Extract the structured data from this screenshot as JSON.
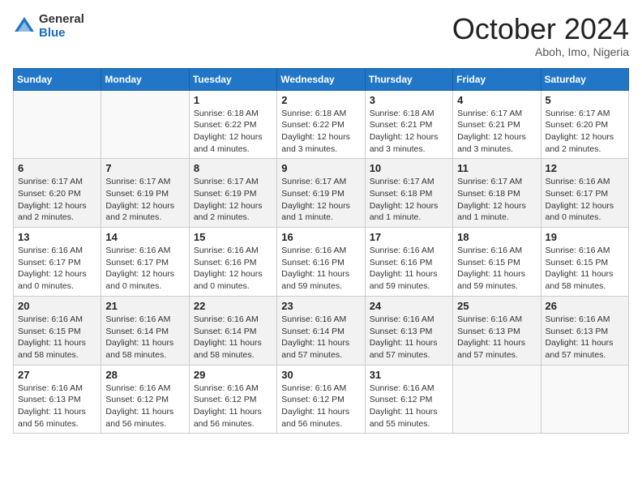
{
  "logo": {
    "general": "General",
    "blue": "Blue"
  },
  "title": "October 2024",
  "subtitle": "Aboh, Imo, Nigeria",
  "days_of_week": [
    "Sunday",
    "Monday",
    "Tuesday",
    "Wednesday",
    "Thursday",
    "Friday",
    "Saturday"
  ],
  "weeks": [
    [
      {
        "day": "",
        "info": ""
      },
      {
        "day": "",
        "info": ""
      },
      {
        "day": "1",
        "info": "Sunrise: 6:18 AM\nSunset: 6:22 PM\nDaylight: 12 hours and 4 minutes."
      },
      {
        "day": "2",
        "info": "Sunrise: 6:18 AM\nSunset: 6:22 PM\nDaylight: 12 hours and 3 minutes."
      },
      {
        "day": "3",
        "info": "Sunrise: 6:18 AM\nSunset: 6:21 PM\nDaylight: 12 hours and 3 minutes."
      },
      {
        "day": "4",
        "info": "Sunrise: 6:17 AM\nSunset: 6:21 PM\nDaylight: 12 hours and 3 minutes."
      },
      {
        "day": "5",
        "info": "Sunrise: 6:17 AM\nSunset: 6:20 PM\nDaylight: 12 hours and 2 minutes."
      }
    ],
    [
      {
        "day": "6",
        "info": "Sunrise: 6:17 AM\nSunset: 6:20 PM\nDaylight: 12 hours and 2 minutes."
      },
      {
        "day": "7",
        "info": "Sunrise: 6:17 AM\nSunset: 6:19 PM\nDaylight: 12 hours and 2 minutes."
      },
      {
        "day": "8",
        "info": "Sunrise: 6:17 AM\nSunset: 6:19 PM\nDaylight: 12 hours and 2 minutes."
      },
      {
        "day": "9",
        "info": "Sunrise: 6:17 AM\nSunset: 6:19 PM\nDaylight: 12 hours and 1 minute."
      },
      {
        "day": "10",
        "info": "Sunrise: 6:17 AM\nSunset: 6:18 PM\nDaylight: 12 hours and 1 minute."
      },
      {
        "day": "11",
        "info": "Sunrise: 6:17 AM\nSunset: 6:18 PM\nDaylight: 12 hours and 1 minute."
      },
      {
        "day": "12",
        "info": "Sunrise: 6:16 AM\nSunset: 6:17 PM\nDaylight: 12 hours and 0 minutes."
      }
    ],
    [
      {
        "day": "13",
        "info": "Sunrise: 6:16 AM\nSunset: 6:17 PM\nDaylight: 12 hours and 0 minutes."
      },
      {
        "day": "14",
        "info": "Sunrise: 6:16 AM\nSunset: 6:17 PM\nDaylight: 12 hours and 0 minutes."
      },
      {
        "day": "15",
        "info": "Sunrise: 6:16 AM\nSunset: 6:16 PM\nDaylight: 12 hours and 0 minutes."
      },
      {
        "day": "16",
        "info": "Sunrise: 6:16 AM\nSunset: 6:16 PM\nDaylight: 11 hours and 59 minutes."
      },
      {
        "day": "17",
        "info": "Sunrise: 6:16 AM\nSunset: 6:16 PM\nDaylight: 11 hours and 59 minutes."
      },
      {
        "day": "18",
        "info": "Sunrise: 6:16 AM\nSunset: 6:15 PM\nDaylight: 11 hours and 59 minutes."
      },
      {
        "day": "19",
        "info": "Sunrise: 6:16 AM\nSunset: 6:15 PM\nDaylight: 11 hours and 58 minutes."
      }
    ],
    [
      {
        "day": "20",
        "info": "Sunrise: 6:16 AM\nSunset: 6:15 PM\nDaylight: 11 hours and 58 minutes."
      },
      {
        "day": "21",
        "info": "Sunrise: 6:16 AM\nSunset: 6:14 PM\nDaylight: 11 hours and 58 minutes."
      },
      {
        "day": "22",
        "info": "Sunrise: 6:16 AM\nSunset: 6:14 PM\nDaylight: 11 hours and 58 minutes."
      },
      {
        "day": "23",
        "info": "Sunrise: 6:16 AM\nSunset: 6:14 PM\nDaylight: 11 hours and 57 minutes."
      },
      {
        "day": "24",
        "info": "Sunrise: 6:16 AM\nSunset: 6:13 PM\nDaylight: 11 hours and 57 minutes."
      },
      {
        "day": "25",
        "info": "Sunrise: 6:16 AM\nSunset: 6:13 PM\nDaylight: 11 hours and 57 minutes."
      },
      {
        "day": "26",
        "info": "Sunrise: 6:16 AM\nSunset: 6:13 PM\nDaylight: 11 hours and 57 minutes."
      }
    ],
    [
      {
        "day": "27",
        "info": "Sunrise: 6:16 AM\nSunset: 6:13 PM\nDaylight: 11 hours and 56 minutes."
      },
      {
        "day": "28",
        "info": "Sunrise: 6:16 AM\nSunset: 6:12 PM\nDaylight: 11 hours and 56 minutes."
      },
      {
        "day": "29",
        "info": "Sunrise: 6:16 AM\nSunset: 6:12 PM\nDaylight: 11 hours and 56 minutes."
      },
      {
        "day": "30",
        "info": "Sunrise: 6:16 AM\nSunset: 6:12 PM\nDaylight: 11 hours and 56 minutes."
      },
      {
        "day": "31",
        "info": "Sunrise: 6:16 AM\nSunset: 6:12 PM\nDaylight: 11 hours and 55 minutes."
      },
      {
        "day": "",
        "info": ""
      },
      {
        "day": "",
        "info": ""
      }
    ]
  ]
}
